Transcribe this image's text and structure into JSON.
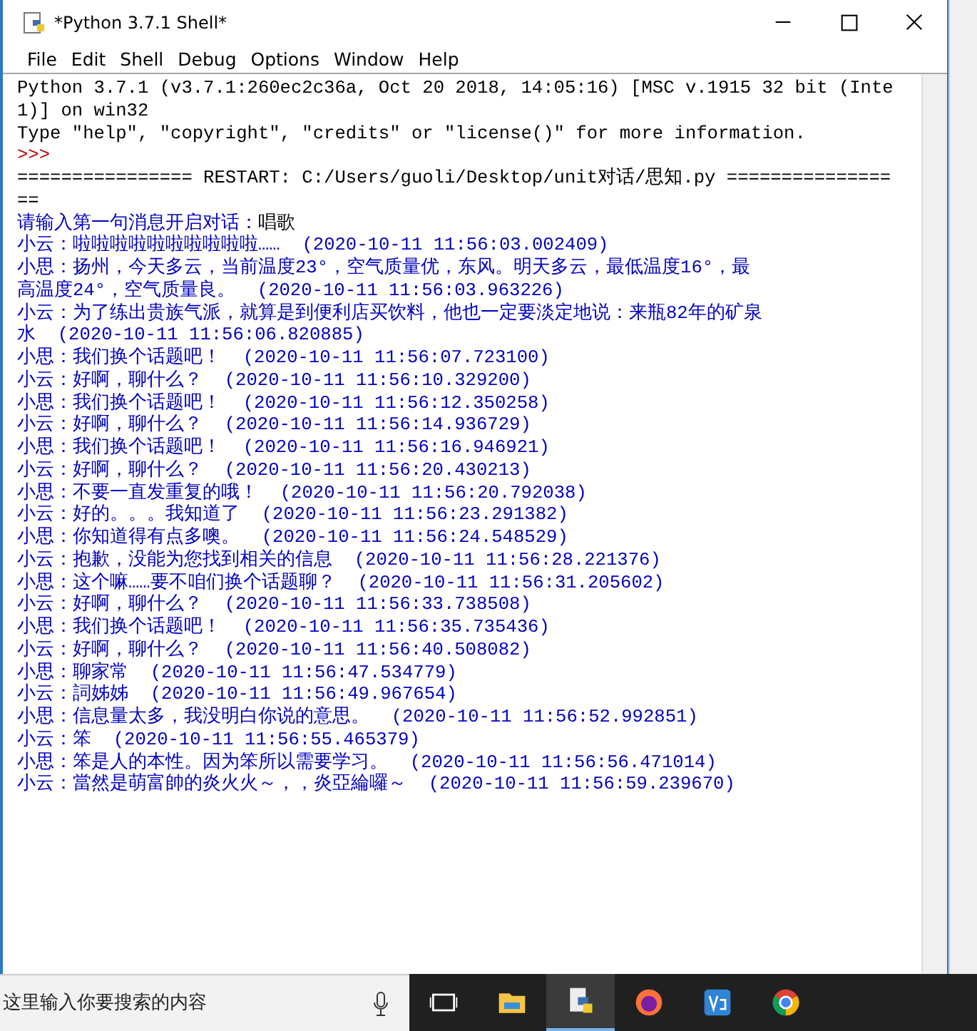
{
  "window": {
    "title": "*Python 3.7.1 Shell*"
  },
  "menu": [
    {
      "label": "File"
    },
    {
      "label": "Edit"
    },
    {
      "label": "Shell"
    },
    {
      "label": "Debug"
    },
    {
      "label": "Options"
    },
    {
      "label": "Window"
    },
    {
      "label": "Help"
    }
  ],
  "lines": [
    {
      "kind": "output",
      "text": "Python 3.7.1 (v3.7.1:260ec2c36a, Oct 20 2018, 14:05:16) [MSC v.1915 32 bit (Inte"
    },
    {
      "kind": "output",
      "text": "1)] on win32"
    },
    {
      "kind": "output",
      "text": "Type \"help\", \"copyright\", \"credits\" or \"license()\" for more information."
    },
    {
      "kind": "prompt",
      "text": ">>>"
    },
    {
      "kind": "output",
      "text": "================ RESTART: C:/Users/guoli/Desktop/unit对话/思知.py ==============="
    },
    {
      "kind": "output",
      "text": "=="
    },
    {
      "kind": "stdin",
      "text": "请输入第一句消息开启对话：",
      "input": "唱歌"
    },
    {
      "kind": "stdout",
      "text": "小云：啦啦啦啦啦啦啦啦啦啦……  (2020-10-11 11:56:03.002409)"
    },
    {
      "kind": "stdout",
      "text": "小思：扬州，今天多云，当前温度23°，空气质量优，东风。明天多云，最低温度16°，最"
    },
    {
      "kind": "stdout",
      "text": "高温度24°，空气质量良。  (2020-10-11 11:56:03.963226)"
    },
    {
      "kind": "stdout",
      "text": "小云：为了练出贵族气派，就算是到便利店买饮料，他也一定要淡定地说：来瓶82年的矿泉"
    },
    {
      "kind": "stdout",
      "text": "水  (2020-10-11 11:56:06.820885)"
    },
    {
      "kind": "stdout",
      "text": "小思：我们换个话题吧！  (2020-10-11 11:56:07.723100)"
    },
    {
      "kind": "stdout",
      "text": "小云：好啊，聊什么？  (2020-10-11 11:56:10.329200)"
    },
    {
      "kind": "stdout",
      "text": "小思：我们换个话题吧！  (2020-10-11 11:56:12.350258)"
    },
    {
      "kind": "stdout",
      "text": "小云：好啊，聊什么？  (2020-10-11 11:56:14.936729)"
    },
    {
      "kind": "stdout",
      "text": "小思：我们换个话题吧！  (2020-10-11 11:56:16.946921)"
    },
    {
      "kind": "stdout",
      "text": "小云：好啊，聊什么？  (2020-10-11 11:56:20.430213)"
    },
    {
      "kind": "stdout",
      "text": "小思：不要一直发重复的哦！  (2020-10-11 11:56:20.792038)"
    },
    {
      "kind": "stdout",
      "text": "小云：好的。。。我知道了  (2020-10-11 11:56:23.291382)"
    },
    {
      "kind": "stdout",
      "text": "小思：你知道得有点多噢。  (2020-10-11 11:56:24.548529)"
    },
    {
      "kind": "stdout",
      "text": "小云：抱歉，没能为您找到相关的信息  (2020-10-11 11:56:28.221376)"
    },
    {
      "kind": "stdout",
      "text": "小思：这个嘛……要不咱们换个话题聊？  (2020-10-11 11:56:31.205602)"
    },
    {
      "kind": "stdout",
      "text": "小云：好啊，聊什么？  (2020-10-11 11:56:33.738508)"
    },
    {
      "kind": "stdout",
      "text": "小思：我们换个话题吧！  (2020-10-11 11:56:35.735436)"
    },
    {
      "kind": "stdout",
      "text": "小云：好啊，聊什么？  (2020-10-11 11:56:40.508082)"
    },
    {
      "kind": "stdout",
      "text": "小思：聊家常  (2020-10-11 11:56:47.534779)"
    },
    {
      "kind": "stdout",
      "text": "小云：詞姊姊  (2020-10-11 11:56:49.967654)"
    },
    {
      "kind": "stdout",
      "text": "小思：信息量太多，我没明白你说的意思。  (2020-10-11 11:56:52.992851)"
    },
    {
      "kind": "stdout",
      "text": "小云：笨  (2020-10-11 11:56:55.465379)"
    },
    {
      "kind": "stdout",
      "text": "小思：笨是人的本性。因为笨所以需要学习。  (2020-10-11 11:56:56.471014)"
    },
    {
      "kind": "stdout",
      "text": "小云：當然是萌富帥的炎火火～，，炎亞綸囉～  (2020-10-11 11:56:59.239670)"
    }
  ],
  "taskbar": {
    "search": {
      "placeholder": "这里输入你要搜索的内容"
    },
    "apps": [
      {
        "kind": "taskview",
        "selected": false
      },
      {
        "kind": "folder",
        "selected": false
      },
      {
        "kind": "python",
        "selected": true
      },
      {
        "kind": "firefox",
        "selected": false
      },
      {
        "kind": "vs",
        "selected": false
      },
      {
        "kind": "chrome",
        "selected": false
      }
    ]
  }
}
